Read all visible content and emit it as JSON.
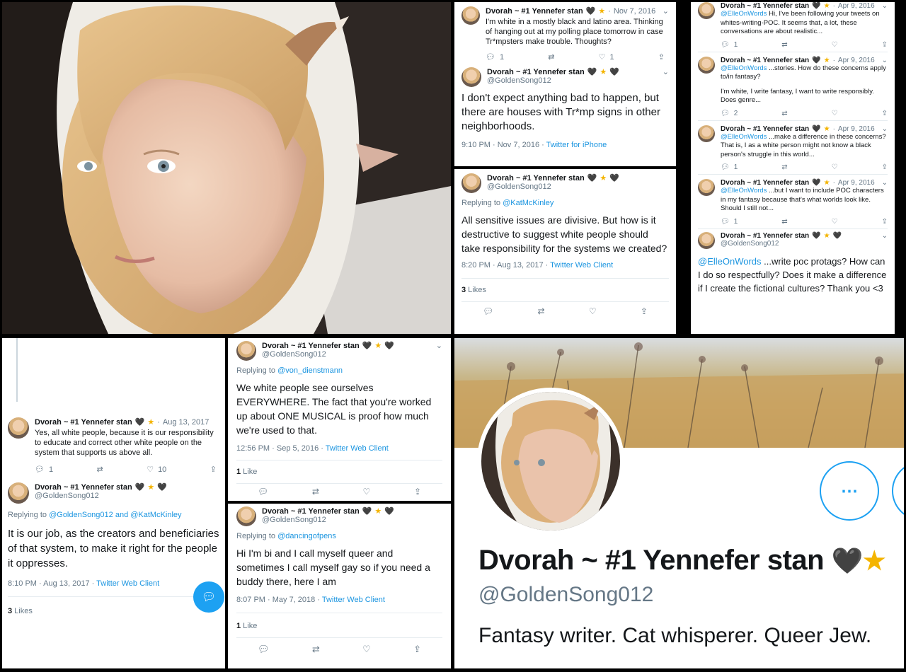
{
  "profile": {
    "display_name": "Dvorah ~ #1 Yennefer stan",
    "handle": "@GoldenSong012",
    "bio": "Fantasy writer. Cat whisperer. Queer Jew."
  },
  "tweet_nov2016": {
    "name": "Dvorah ~ #1 Yennefer stan",
    "date": "Nov 7, 2016",
    "parent_text": "I'm white in a mostly black and latino area. Thinking of hanging out at my polling place tomorrow in case Tr*mpsters make trouble. Thoughts?",
    "parent_replies": "1",
    "parent_likes": "1",
    "handle": "@GoldenSong012",
    "text": "I don't expect anything bad to happen, but there are houses with Tr*mp signs in other neighborhoods.",
    "meta_time": "9:10 PM · Nov 7, 2016 · ",
    "meta_client": "Twitter for iPhone"
  },
  "tweet_aug2017a": {
    "name": "Dvorah ~ #1 Yennefer stan",
    "handle": "@GoldenSong012",
    "replying_prefix": "Replying to ",
    "replying_to": "@KatMcKinley",
    "text": "All sensitive issues are divisive. But how is it destructive to suggest white people should take responsibility for the systems we created?",
    "meta_time": "8:20 PM · Aug 13, 2017 · ",
    "meta_client": "Twitter Web Client",
    "likes_count": "3",
    "likes_label": " Likes"
  },
  "thread_apr2016": {
    "items": [
      {
        "name": "Dvorah ~ #1 Yennefer stan",
        "date": "Apr 9, 2016",
        "mention": "@ElleOnWords",
        "text": " Hi, I've been following your tweets on whites-writing-POC. It seems that, a lot, these conversations are about realistic...",
        "replies": "1"
      },
      {
        "name": "Dvorah ~ #1 Yennefer stan",
        "date": "Apr 9, 2016",
        "mention": "@ElleOnWords",
        "text": " ...stories. How do these concerns apply to/in fantasy?",
        "text2": "I'm white, I write fantasy, I want to write responsibly. Does genre...",
        "replies": "2"
      },
      {
        "name": "Dvorah ~ #1 Yennefer stan",
        "date": "Apr 9, 2016",
        "mention": "@ElleOnWords",
        "text": " ...make a difference in these concerns? That is, I as a white person might not know a black person's struggle in this world...",
        "replies": "1"
      },
      {
        "name": "Dvorah ~ #1 Yennefer stan",
        "date": "Apr 9, 2016",
        "mention": "@ElleOnWords",
        "text": " ...but I want to include POC characters in my fantasy because that's what worlds look like. Should I still not...",
        "replies": "1"
      }
    ],
    "final": {
      "name": "Dvorah ~ #1 Yennefer stan",
      "handle": "@GoldenSong012",
      "mention": "@ElleOnWords",
      "text": " ...write poc protags? How can I do so respectfully? Does it make a difference if I create the fictional cultures? Thank you <3"
    }
  },
  "tweet_aug2017b": {
    "parent_name": "Dvorah ~ #1 Yennefer stan",
    "parent_date": "Aug 13, 2017",
    "parent_text": "Yes, all white people, because it is our responsibility to educate and correct other white people on the system that supports us above all.",
    "parent_replies": "1",
    "parent_likes": "10",
    "name": "Dvorah ~ #1 Yennefer stan",
    "handle": "@GoldenSong012",
    "replying_prefix": "Replying to ",
    "replying_to": "@GoldenSong012 and @KatMcKinley",
    "text": "It is our job, as the creators and beneficiaries of that system, to make it right for the people it oppresses.",
    "meta_time": "8:10 PM · Aug 13, 2017 · ",
    "meta_client": "Twitter Web Client",
    "likes_count": "3",
    "likes_label": " Likes"
  },
  "tweet_sep2016": {
    "name": "Dvorah ~ #1 Yennefer stan",
    "handle": "@GoldenSong012",
    "replying_prefix": "Replying to ",
    "replying_to": "@von_dienstmann",
    "text": "We white people see ourselves EVERYWHERE. The fact that you're worked up about ONE MUSICAL is proof how much we're used to that.",
    "meta_time": "12:56 PM · Sep 5, 2016 · ",
    "meta_client": "Twitter Web Client",
    "likes_count": "1",
    "likes_label": " Like"
  },
  "tweet_may2018": {
    "name": "Dvorah ~ #1 Yennefer stan",
    "handle": "@GoldenSong012",
    "replying_prefix": "Replying to ",
    "replying_to": "@dancingofpens",
    "text": "Hi I'm bi and I call myself queer and sometimes I call myself gay so if you need a buddy there, here I am",
    "meta_time": "8:07 PM · May 7, 2018 · ",
    "meta_client": "Twitter Web Client",
    "likes_count": "1",
    "likes_label": " Like"
  },
  "colors": {
    "twitter_blue": "#1b95e0",
    "secondary_text": "#657786",
    "heart": "#292f33",
    "star": "#f4b400"
  }
}
